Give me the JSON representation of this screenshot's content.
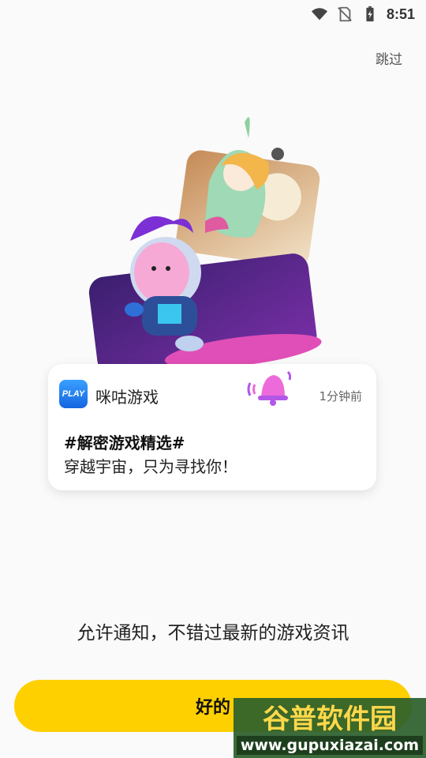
{
  "status_bar": {
    "time": "8:51"
  },
  "header": {
    "skip_label": "跳过"
  },
  "notification": {
    "app_icon_text": "PLAY",
    "app_name": "咪咕游戏",
    "time_ago": "1分钟前",
    "title": "#解密游戏精选#",
    "body": "穿越宇宙，只为寻找你！"
  },
  "headline": "允许通知，不错过最新的游戏资讯",
  "ok_button_label": "好的",
  "watermark": {
    "brand": "谷普软件园",
    "url": "www.gupuxiazai.com"
  },
  "colors": {
    "accent": "#ffd000",
    "background": "#fafafa"
  }
}
